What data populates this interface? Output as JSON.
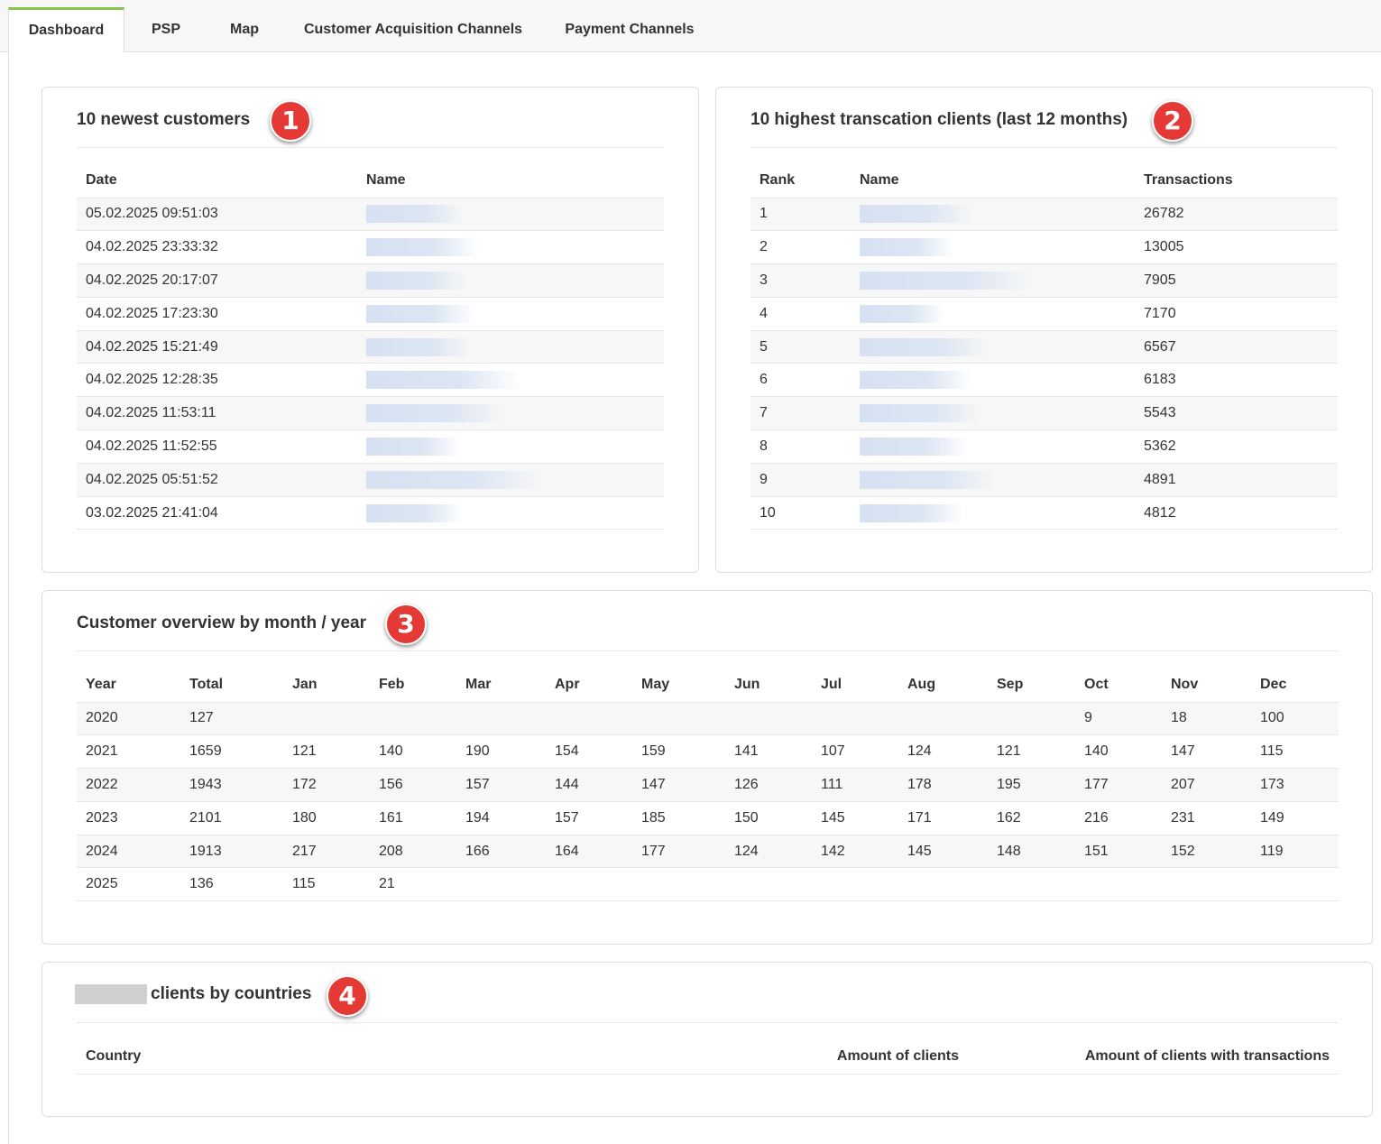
{
  "tabs": [
    {
      "label": "Dashboard",
      "active": true
    },
    {
      "label": "PSP",
      "active": false
    },
    {
      "label": "Map",
      "active": false
    },
    {
      "label": "Customer Acquisition Channels",
      "active": false
    },
    {
      "label": "Payment Channels",
      "active": false
    }
  ],
  "newest_customers": {
    "title": "10 newest customers",
    "marker": "1",
    "columns": [
      "Date",
      "Name"
    ],
    "rows": [
      {
        "date": "05.02.2025 09:51:03",
        "name_redacted": true
      },
      {
        "date": "04.02.2025 23:33:32",
        "name_redacted": true
      },
      {
        "date": "04.02.2025 20:17:07",
        "name_redacted": true
      },
      {
        "date": "04.02.2025 17:23:30",
        "name_redacted": true
      },
      {
        "date": "04.02.2025 15:21:49",
        "name_redacted": true
      },
      {
        "date": "04.02.2025 12:28:35",
        "name_redacted": true
      },
      {
        "date": "04.02.2025 11:53:11",
        "name_redacted": true
      },
      {
        "date": "04.02.2025 11:52:55",
        "name_redacted": true
      },
      {
        "date": "04.02.2025 05:51:52",
        "name_redacted": true
      },
      {
        "date": "03.02.2025 21:41:04",
        "name_redacted": true
      }
    ]
  },
  "top_clients": {
    "title": "10 highest transcation clients (last 12 months)",
    "marker": "2",
    "columns": [
      "Rank",
      "Name",
      "Transactions"
    ],
    "rows": [
      {
        "rank": "1",
        "transactions": "26782"
      },
      {
        "rank": "2",
        "transactions": "13005"
      },
      {
        "rank": "3",
        "transactions": "7905"
      },
      {
        "rank": "4",
        "transactions": "7170"
      },
      {
        "rank": "5",
        "transactions": "6567"
      },
      {
        "rank": "6",
        "transactions": "6183"
      },
      {
        "rank": "7",
        "transactions": "5543"
      },
      {
        "rank": "8",
        "transactions": "5362"
      },
      {
        "rank": "9",
        "transactions": "4891"
      },
      {
        "rank": "10",
        "transactions": "4812"
      }
    ]
  },
  "overview": {
    "title": "Customer overview by month / year",
    "marker": "3",
    "columns": [
      "Year",
      "Total",
      "Jan",
      "Feb",
      "Mar",
      "Apr",
      "May",
      "Jun",
      "Jul",
      "Aug",
      "Sep",
      "Oct",
      "Nov",
      "Dec"
    ],
    "rows": [
      [
        "2020",
        "127",
        "",
        "",
        "",
        "",
        "",
        "",
        "",
        "",
        "",
        "9",
        "18",
        "100"
      ],
      [
        "2021",
        "1659",
        "121",
        "140",
        "190",
        "154",
        "159",
        "141",
        "107",
        "124",
        "121",
        "140",
        "147",
        "115"
      ],
      [
        "2022",
        "1943",
        "172",
        "156",
        "157",
        "144",
        "147",
        "126",
        "111",
        "178",
        "195",
        "177",
        "207",
        "173"
      ],
      [
        "2023",
        "2101",
        "180",
        "161",
        "194",
        "157",
        "185",
        "150",
        "145",
        "171",
        "162",
        "216",
        "231",
        "149"
      ],
      [
        "2024",
        "1913",
        "217",
        "208",
        "166",
        "164",
        "177",
        "124",
        "142",
        "145",
        "148",
        "151",
        "152",
        "119"
      ],
      [
        "2025",
        "136",
        "115",
        "21",
        "",
        "",
        "",
        "",
        "",
        "",
        "",
        "",
        "",
        ""
      ]
    ]
  },
  "countries": {
    "title": "clients by countries",
    "marker": "4",
    "columns": [
      "Country",
      "Amount of clients",
      "Amount of clients with transactions"
    ]
  },
  "colors": {
    "active_tab_accent": "#8bc34a",
    "marker_red": "#e53935",
    "redaction_blue": "#d6e1f1",
    "row_stripe": "#f7f7f7"
  }
}
